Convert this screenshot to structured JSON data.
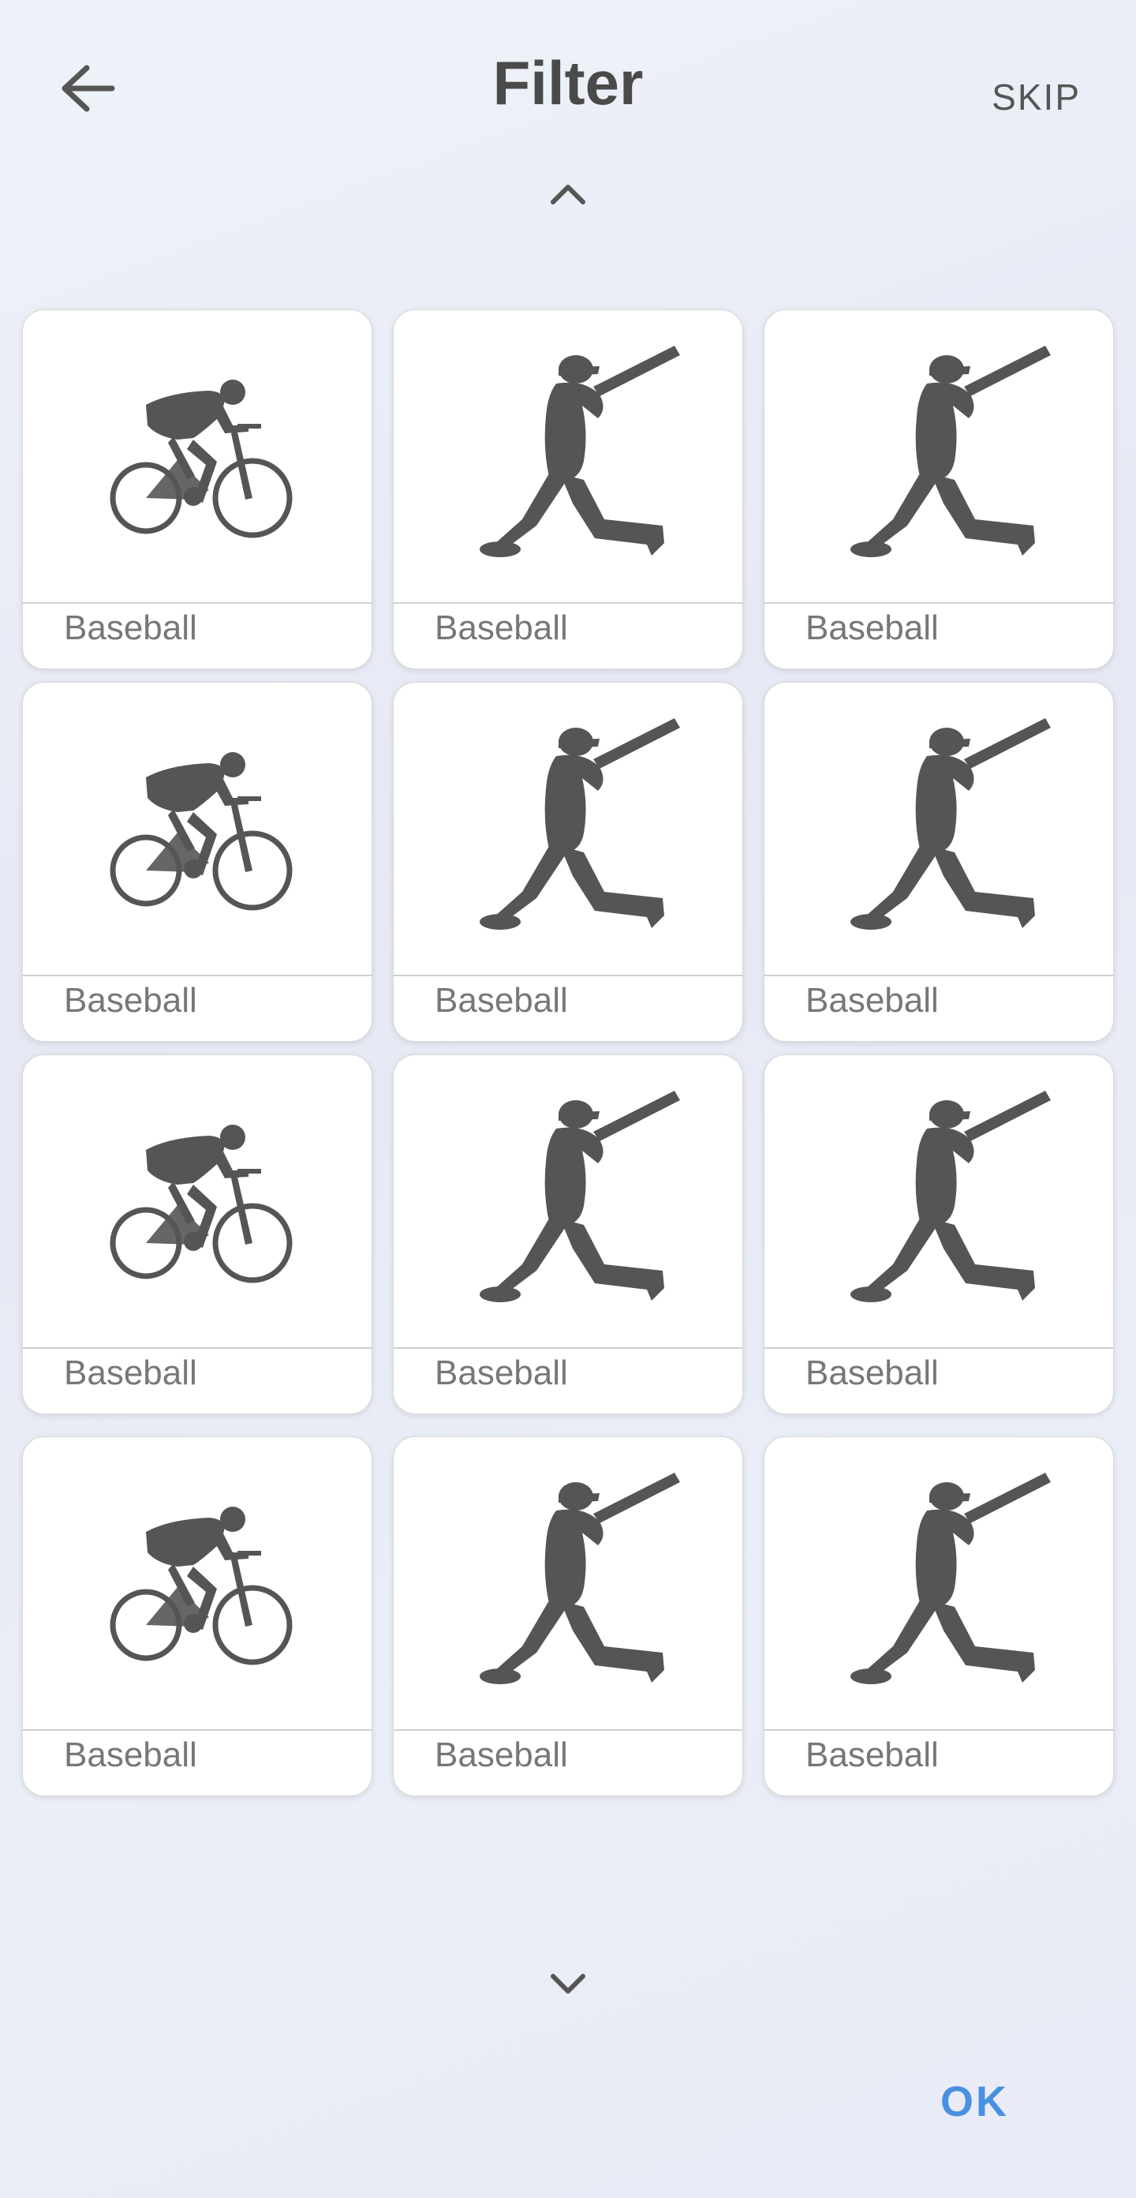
{
  "header": {
    "title": "Filter",
    "skip_label": "SKIP"
  },
  "icons": {
    "back": "arrow-left-icon",
    "up": "chevron-up-icon",
    "down": "chevron-down-icon"
  },
  "cards": [
    {
      "label": "Baseball",
      "image": "cyclist-icon"
    },
    {
      "label": "Baseball",
      "image": "baseball-batter-icon"
    },
    {
      "label": "Baseball",
      "image": "baseball-batter-icon"
    },
    {
      "label": "Baseball",
      "image": "cyclist-icon"
    },
    {
      "label": "Baseball",
      "image": "baseball-batter-icon"
    },
    {
      "label": "Baseball",
      "image": "baseball-batter-icon"
    },
    {
      "label": "Baseball",
      "image": "cyclist-icon"
    },
    {
      "label": "Baseball",
      "image": "baseball-batter-icon"
    },
    {
      "label": "Baseball",
      "image": "baseball-batter-icon"
    },
    {
      "label": "Baseball",
      "image": "cyclist-icon"
    },
    {
      "label": "Baseball",
      "image": "baseball-batter-icon"
    },
    {
      "label": "Baseball",
      "image": "baseball-batter-icon"
    }
  ],
  "footer": {
    "ok_label": "OK"
  },
  "colors": {
    "accent": "#4a90e2",
    "icon": "#555555"
  }
}
